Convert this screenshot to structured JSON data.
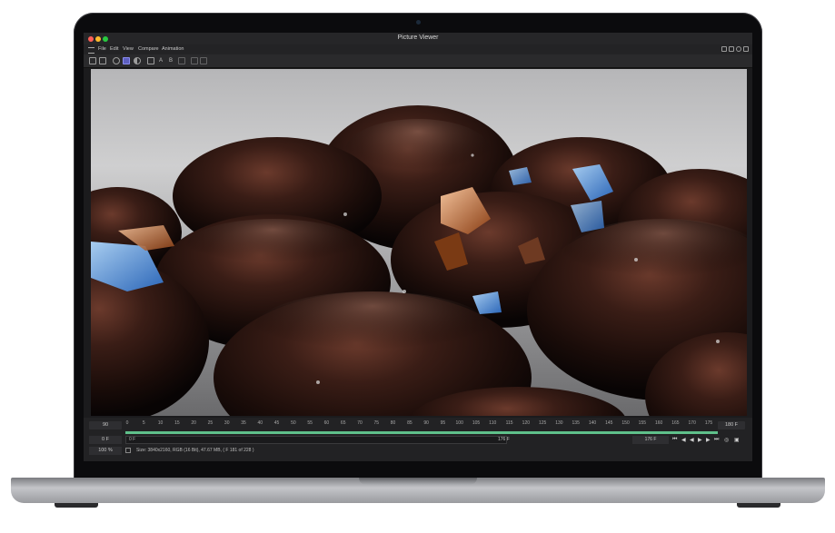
{
  "window": {
    "title": "Picture Viewer"
  },
  "menu": [
    "File",
    "Edit",
    "View",
    "Compare",
    "Animation"
  ],
  "toolbar": {
    "letter_a": "A",
    "letter_b": "B"
  },
  "timeline": {
    "start_frame": "90",
    "end_frame": "180 F",
    "ticks": [
      "0",
      "5",
      "10",
      "15",
      "20",
      "25",
      "30",
      "35",
      "40",
      "45",
      "50",
      "55",
      "60",
      "65",
      "70",
      "75",
      "80",
      "85",
      "90",
      "95",
      "100",
      "105",
      "110",
      "115",
      "120",
      "125",
      "130",
      "135",
      "140",
      "145",
      "150",
      "155",
      "160",
      "165",
      "170",
      "175"
    ],
    "current_frame": "0 F",
    "playback_label": "0 F",
    "range_end_label": "176 F",
    "fps_field": "176 F"
  },
  "status": {
    "zoom": "100 %",
    "info": "Size: 3840x2160, RGB (16 Bit), 47.67 MB, ( F 181 of 228 )"
  },
  "colors": {
    "accent": "#5d5fbf",
    "timeline_green": "#5fc08a"
  }
}
